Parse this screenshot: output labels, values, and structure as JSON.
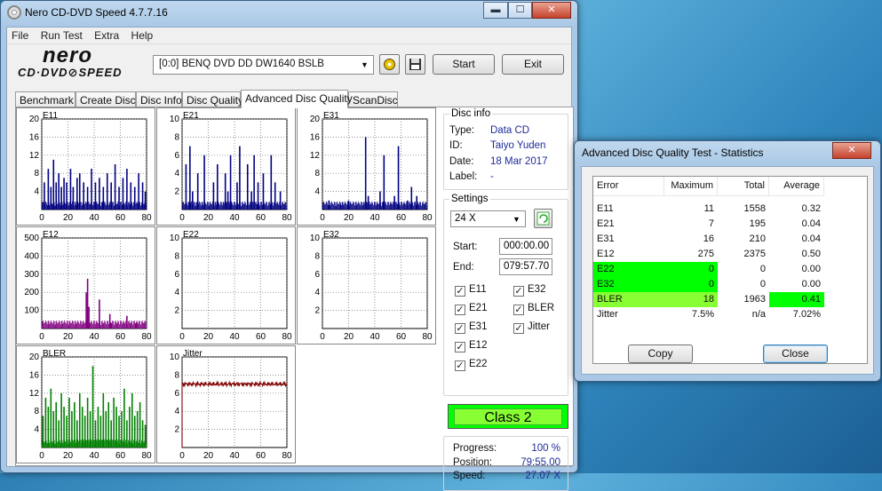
{
  "window": {
    "title": "Nero CD-DVD Speed 4.7.7.16",
    "min": "▬",
    "max": "☐",
    "close": "✕"
  },
  "menu": [
    "File",
    "Run Test",
    "Extra",
    "Help"
  ],
  "logo": {
    "top": "nero",
    "bottom": "CD·DVD⊘SPEED"
  },
  "drive": {
    "value": "[0:0]  BENQ DVD DD DW1640 BSLB"
  },
  "buttons": {
    "start": "Start",
    "exit": "Exit"
  },
  "tabs": [
    "Benchmark",
    "Create Disc",
    "Disc Info",
    "Disc Quality",
    "Advanced Disc Quality",
    "ScanDisc"
  ],
  "active_tab": "Advanced Disc Quality",
  "disc_info": {
    "heading": "Disc info",
    "type_label": "Type:",
    "type": "Data CD",
    "id_label": "ID:",
    "id": "Taiyo Yuden",
    "date_label": "Date:",
    "date": "18 Mar 2017",
    "label_label": "Label:",
    "label": "-"
  },
  "settings": {
    "heading": "Settings",
    "speed": "24 X",
    "start_label": "Start:",
    "start": "000:00.00",
    "end_label": "End:",
    "end": "079:57.70"
  },
  "checks": [
    {
      "label": "E11",
      "checked": true
    },
    {
      "label": "E32",
      "checked": true
    },
    {
      "label": "E21",
      "checked": true
    },
    {
      "label": "BLER",
      "checked": true
    },
    {
      "label": "E31",
      "checked": true
    },
    {
      "label": "Jitter",
      "checked": true
    },
    {
      "label": "E12",
      "checked": true
    },
    {
      "label": "E22",
      "checked": true
    }
  ],
  "quality_class": "Class 2",
  "progress": {
    "progress_label": "Progress:",
    "progress": "100 %",
    "position_label": "Position:",
    "position": "79:55.00",
    "speed_label": "Speed:",
    "speed": "27.07 X"
  },
  "colors": {
    "e1x": "#000080",
    "e12": "#800080",
    "bler": "#008000",
    "jitter": "#800000",
    "green": "#00ff00",
    "lime": "#88ff33"
  },
  "chart_data": [
    {
      "type": "bar",
      "title": "E11",
      "xlim": [
        0,
        80
      ],
      "ylim": [
        0,
        20
      ],
      "yticks": [
        4,
        8,
        12,
        16,
        20
      ],
      "xticks": [
        0,
        20,
        40,
        60,
        80
      ],
      "color": "#000080",
      "peaks": [
        [
          2,
          6
        ],
        [
          5,
          9
        ],
        [
          7,
          5
        ],
        [
          9,
          11
        ],
        [
          11,
          6
        ],
        [
          13,
          8
        ],
        [
          15,
          5
        ],
        [
          17,
          7
        ],
        [
          19,
          6
        ],
        [
          22,
          9
        ],
        [
          24,
          5
        ],
        [
          27,
          7
        ],
        [
          29,
          8
        ],
        [
          32,
          6
        ],
        [
          35,
          5
        ],
        [
          38,
          9
        ],
        [
          41,
          6
        ],
        [
          44,
          7
        ],
        [
          47,
          5
        ],
        [
          50,
          8
        ],
        [
          53,
          6
        ],
        [
          56,
          10
        ],
        [
          59,
          5
        ],
        [
          62,
          7
        ],
        [
          65,
          9
        ],
        [
          68,
          6
        ],
        [
          71,
          5
        ],
        [
          74,
          8
        ],
        [
          77,
          6
        ],
        [
          79,
          4
        ]
      ]
    },
    {
      "type": "bar",
      "title": "E21",
      "xlim": [
        0,
        80
      ],
      "ylim": [
        0,
        10
      ],
      "yticks": [
        2,
        4,
        6,
        8,
        10
      ],
      "xticks": [
        0,
        20,
        40,
        60,
        80
      ],
      "color": "#000080",
      "peaks": [
        [
          3,
          5
        ],
        [
          6,
          7
        ],
        [
          8,
          2
        ],
        [
          12,
          4
        ],
        [
          17,
          6
        ],
        [
          24,
          3
        ],
        [
          27,
          5
        ],
        [
          33,
          4
        ],
        [
          35,
          2
        ],
        [
          37,
          6
        ],
        [
          42,
          3
        ],
        [
          44,
          7
        ],
        [
          50,
          5
        ],
        [
          53,
          2
        ],
        [
          55,
          6
        ],
        [
          58,
          3
        ],
        [
          62,
          4
        ],
        [
          68,
          6
        ],
        [
          71,
          3
        ],
        [
          75,
          2
        ]
      ]
    },
    {
      "type": "bar",
      "title": "E31",
      "xlim": [
        0,
        80
      ],
      "ylim": [
        0,
        20
      ],
      "yticks": [
        4,
        8,
        12,
        16,
        20
      ],
      "xticks": [
        0,
        20,
        40,
        60,
        80
      ],
      "color": "#000080",
      "peaks": [
        [
          5,
          2
        ],
        [
          14,
          1
        ],
        [
          20,
          2
        ],
        [
          33,
          16
        ],
        [
          35,
          3
        ],
        [
          44,
          4
        ],
        [
          47,
          12
        ],
        [
          55,
          3
        ],
        [
          58,
          14
        ],
        [
          65,
          2
        ],
        [
          68,
          5
        ],
        [
          72,
          3
        ]
      ]
    },
    {
      "type": "bar",
      "title": "E12",
      "xlim": [
        0,
        80
      ],
      "ylim": [
        0,
        500
      ],
      "yticks": [
        100,
        200,
        300,
        400,
        500
      ],
      "xticks": [
        0,
        20,
        40,
        60,
        80
      ],
      "color": "#800080",
      "peaks": [
        [
          34,
          200
        ],
        [
          35,
          275
        ],
        [
          36,
          120
        ],
        [
          44,
          160
        ],
        [
          52,
          80
        ],
        [
          53,
          30
        ],
        [
          65,
          70
        ],
        [
          72,
          30
        ]
      ]
    },
    {
      "type": "bar",
      "title": "E22",
      "xlim": [
        0,
        80
      ],
      "ylim": [
        0,
        10
      ],
      "yticks": [
        2,
        4,
        6,
        8,
        10
      ],
      "xticks": [
        0,
        20,
        40,
        60,
        80
      ],
      "color": "#000080",
      "peaks": []
    },
    {
      "type": "bar",
      "title": "E32",
      "xlim": [
        0,
        80
      ],
      "ylim": [
        0,
        10
      ],
      "yticks": [
        2,
        4,
        6,
        8,
        10
      ],
      "xticks": [
        0,
        20,
        40,
        60,
        80
      ],
      "color": "#000080",
      "peaks": []
    },
    {
      "type": "bar",
      "title": "BLER",
      "xlim": [
        0,
        80
      ],
      "ylim": [
        0,
        20
      ],
      "yticks": [
        4,
        8,
        12,
        16,
        20
      ],
      "xticks": [
        0,
        20,
        40,
        60,
        80
      ],
      "color": "#008000",
      "peaks": [
        [
          1,
          7
        ],
        [
          3,
          11
        ],
        [
          5,
          9
        ],
        [
          7,
          13
        ],
        [
          9,
          8
        ],
        [
          11,
          10
        ],
        [
          13,
          6
        ],
        [
          15,
          12
        ],
        [
          17,
          9
        ],
        [
          19,
          7
        ],
        [
          21,
          11
        ],
        [
          23,
          8
        ],
        [
          25,
          10
        ],
        [
          27,
          6
        ],
        [
          29,
          12
        ],
        [
          31,
          9
        ],
        [
          33,
          7
        ],
        [
          35,
          11
        ],
        [
          37,
          8
        ],
        [
          39,
          18
        ],
        [
          41,
          6
        ],
        [
          43,
          9
        ],
        [
          45,
          7
        ],
        [
          47,
          12
        ],
        [
          49,
          8
        ],
        [
          51,
          10
        ],
        [
          53,
          6
        ],
        [
          55,
          11
        ],
        [
          57,
          9
        ],
        [
          59,
          7
        ],
        [
          61,
          8
        ],
        [
          63,
          13
        ],
        [
          65,
          6
        ],
        [
          67,
          9
        ],
        [
          69,
          12
        ],
        [
          71,
          7
        ],
        [
          73,
          8
        ],
        [
          75,
          10
        ],
        [
          77,
          6
        ],
        [
          79,
          5
        ]
      ]
    },
    {
      "type": "line",
      "title": "Jitter",
      "xlim": [
        0,
        80
      ],
      "ylim": [
        0,
        10
      ],
      "yticks": [
        2,
        4,
        6,
        8,
        10
      ],
      "xticks": [
        0,
        20,
        40,
        60,
        80
      ],
      "color": "#800000",
      "values": [
        [
          0,
          7.0
        ],
        [
          10,
          7.1
        ],
        [
          20,
          6.9
        ],
        [
          30,
          7.2
        ],
        [
          40,
          7.0
        ],
        [
          50,
          7.1
        ],
        [
          60,
          6.9
        ],
        [
          70,
          7.1
        ],
        [
          80,
          7.0
        ]
      ]
    }
  ],
  "stats": {
    "title": "Advanced Disc Quality Test - Statistics",
    "headers": [
      "Error",
      "Maximum",
      "Total",
      "Average"
    ],
    "rows": [
      {
        "error": "E11",
        "max": "11",
        "total": "1558",
        "avg": "0.32",
        "hl_err": false,
        "hl_avg": false
      },
      {
        "error": "E21",
        "max": "7",
        "total": "195",
        "avg": "0.04",
        "hl_err": false,
        "hl_avg": false
      },
      {
        "error": "E31",
        "max": "16",
        "total": "210",
        "avg": "0.04",
        "hl_err": false,
        "hl_avg": false
      },
      {
        "error": "E12",
        "max": "275",
        "total": "2375",
        "avg": "0.50",
        "hl_err": false,
        "hl_avg": false
      },
      {
        "error": "E22",
        "max": "0",
        "total": "0",
        "avg": "0.00",
        "hl_err": true,
        "hl_avg": false
      },
      {
        "error": "E32",
        "max": "0",
        "total": "0",
        "avg": "0.00",
        "hl_err": true,
        "hl_avg": false
      },
      {
        "error": "BLER",
        "max": "18",
        "total": "1963",
        "avg": "0.41",
        "hl_err": true,
        "hl_avg": true
      },
      {
        "error": "Jitter",
        "max": "7.5%",
        "total": "n/a",
        "avg": "7.02%",
        "hl_err": false,
        "hl_avg": false
      }
    ],
    "copy": "Copy",
    "close": "Close",
    "close_x": "✕"
  }
}
